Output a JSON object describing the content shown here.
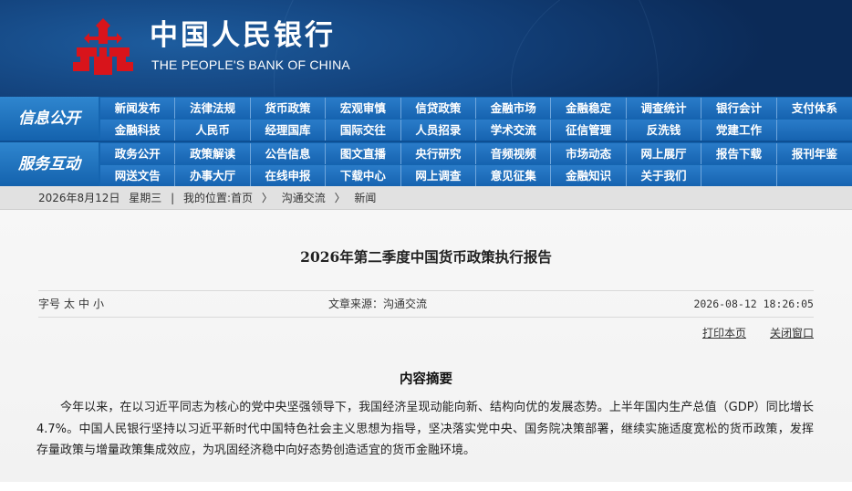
{
  "header": {
    "title_cn": "中国人民银行",
    "title_en": "THE PEOPLE'S BANK OF CHINA"
  },
  "colors": {
    "logo_red": "#d8141b",
    "nav_blue": "#1565b0",
    "header_dark": "#123f78"
  },
  "nav": {
    "info_section": "信息公开",
    "info_row1": [
      "新闻发布",
      "法律法规",
      "货币政策",
      "宏观审慎",
      "信贷政策",
      "金融市场",
      "金融稳定",
      "调查统计",
      "银行会计",
      "支付体系"
    ],
    "info_row2": [
      "金融科技",
      "人民币",
      "经理国库",
      "国际交往",
      "人员招录",
      "学术交流",
      "征信管理",
      "反洗钱",
      "党建工作",
      ""
    ],
    "service_section": "服务互动",
    "service_row1": [
      "政务公开",
      "政策解读",
      "公告信息",
      "图文直播",
      "央行研究",
      "音频视频",
      "市场动态",
      "网上展厅",
      "报告下载",
      "报刊年鉴"
    ],
    "service_row2": [
      "网送文告",
      "办事大厅",
      "在线申报",
      "下载中心",
      "网上调查",
      "意见征集",
      "金融知识",
      "关于我们",
      "",
      ""
    ]
  },
  "breadcrumb": {
    "date": "2026年8月12日",
    "weekday": "星期三",
    "location_label": "我的位置:",
    "home": "首页",
    "sep": "〉",
    "section": "沟通交流",
    "page": "新闻"
  },
  "article": {
    "title": "2026年第二季度中国货币政策执行报告",
    "font_label": "字号",
    "font_sizes": [
      "太",
      "中",
      "小"
    ],
    "source": "文章来源：沟通交流",
    "datetime": "2026-08-12 18:26:05",
    "print_label": "打印本页",
    "close_label": "关闭窗口",
    "summary_heading": "内容摘要",
    "summary_text": "今年以来，在以习近平同志为核心的党中央坚强领导下，我国经济呈现动能向新、结构向优的发展态势。上半年国内生产总值（GDP）同比增长4.7%。中国人民银行坚持以习近平新时代中国特色社会主义思想为指导，坚决落实党中央、国务院决策部署，继续实施适度宽松的货币政策，发挥存量政策与增量政策集成效应，为巩固经济稳中向好态势创造适宜的货币金融环境。"
  }
}
